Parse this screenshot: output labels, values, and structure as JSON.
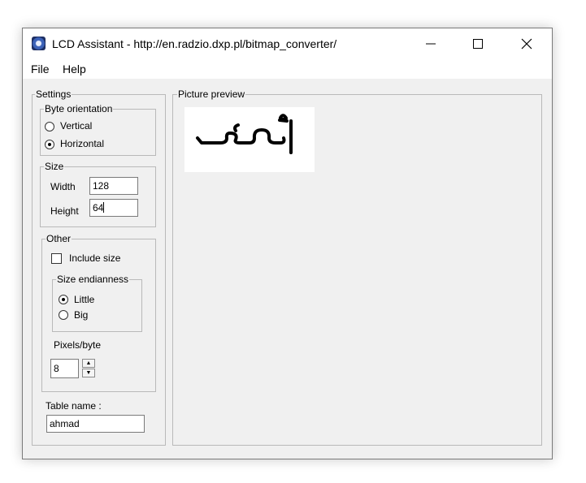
{
  "window": {
    "title": "LCD Assistant -  http://en.radzio.dxp.pl/bitmap_converter/"
  },
  "menu": {
    "file": "File",
    "help": "Help"
  },
  "settings": {
    "label": "Settings",
    "byte_orientation": {
      "label": "Byte orientation",
      "vertical": "Vertical",
      "horizontal": "Horizontal",
      "selected": "Horizontal"
    },
    "size": {
      "label": "Size",
      "width_label": "Width",
      "width_value": "128",
      "height_label": "Height",
      "height_value": "64"
    },
    "other": {
      "label": "Other",
      "include_size": "Include size",
      "include_size_checked": false,
      "endianness": {
        "label": "Size endianness",
        "little": "Little",
        "big": "Big",
        "selected": "Little"
      },
      "pixels_label": "Pixels/byte",
      "pixels_value": "8"
    },
    "table_name_label": "Table name :",
    "table_name_value": "ahmad"
  },
  "preview": {
    "label": "Picture preview"
  },
  "icons": {
    "app": "lcd-app-icon",
    "minimize": "minimize-icon",
    "maximize": "maximize-icon",
    "close": "close-icon",
    "spin_up": "arrow-up-icon",
    "spin_down": "arrow-down-icon"
  }
}
